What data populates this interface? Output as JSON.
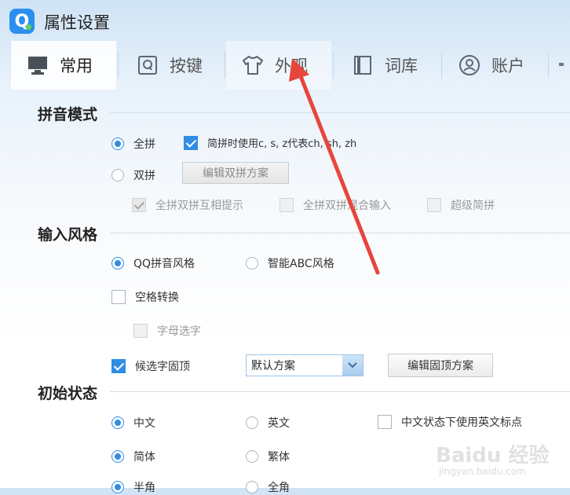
{
  "window": {
    "title": "属性设置",
    "logo_letter": "Q"
  },
  "tabs": [
    {
      "label": "常用",
      "icon": "monitor-icon",
      "state": "active"
    },
    {
      "label": "按键",
      "icon": "key-q-icon",
      "state": "normal"
    },
    {
      "label": "外观",
      "icon": "tshirt-icon",
      "state": "hover"
    },
    {
      "label": "词库",
      "icon": "book-icon",
      "state": "normal"
    },
    {
      "label": "账户",
      "icon": "user-icon",
      "state": "normal"
    }
  ],
  "pinyin": {
    "title": "拼音模式",
    "quanpin": "全拼",
    "shuangpin": "双拼",
    "jianpin_czs": "简拼时使用c, s, z代表ch, sh, zh",
    "edit_shuangpin": "编辑双拼方案",
    "hint_mutual": "全拼双拼互相提示",
    "mixed_input": "全拼双拼混合输入",
    "super_jianpin": "超级简拼"
  },
  "style": {
    "title": "输入风格",
    "qq_style": "QQ拼音风格",
    "abc_style": "智能ABC风格",
    "space_convert": "空格转换",
    "letter_select": "字母选字",
    "candidate_fix": "候选字固顶",
    "scheme_value": "默认方案",
    "edit_fix_scheme": "编辑固顶方案"
  },
  "initial": {
    "title": "初始状态",
    "chinese": "中文",
    "english": "英文",
    "cn_eng_punct": "中文状态下使用英文标点",
    "simplified": "简体",
    "traditional": "繁体",
    "half_width": "半角",
    "full_width": "全角"
  },
  "watermark": {
    "brand": "Baidu 经验",
    "url": "jingyan.baidu.com"
  },
  "colors": {
    "accent": "#2f8de4",
    "arrow": "#e8453c"
  }
}
